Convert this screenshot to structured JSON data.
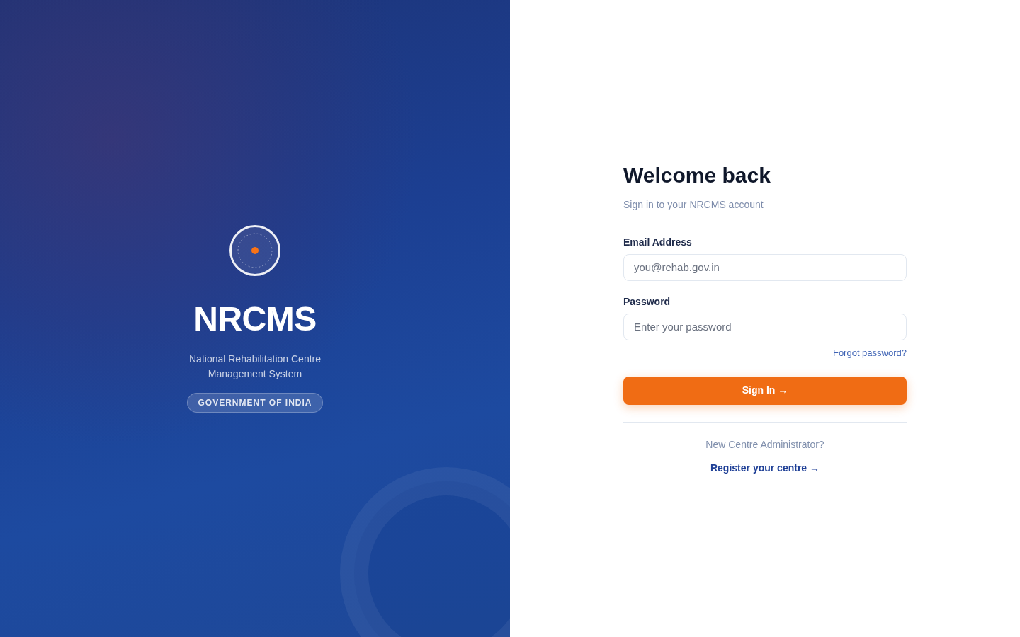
{
  "brand_panel": {
    "title": "NRCMS",
    "subtitle": "National Rehabilitation Centre Management System",
    "badge": "GOVERNMENT OF INDIA"
  },
  "login_form": {
    "heading": "Welcome back",
    "subheading": "Sign in to your NRCMS account",
    "fields": [
      {
        "label": "Email Address",
        "placeholder": "you@rehab.gov.in"
      },
      {
        "label": "Password",
        "placeholder": "Enter your password"
      }
    ],
    "forgot_link": "Forgot password?",
    "submit_button": "Sign In →",
    "register_prompt": "New Centre Administrator?",
    "register_link": "Register your centre →"
  }
}
